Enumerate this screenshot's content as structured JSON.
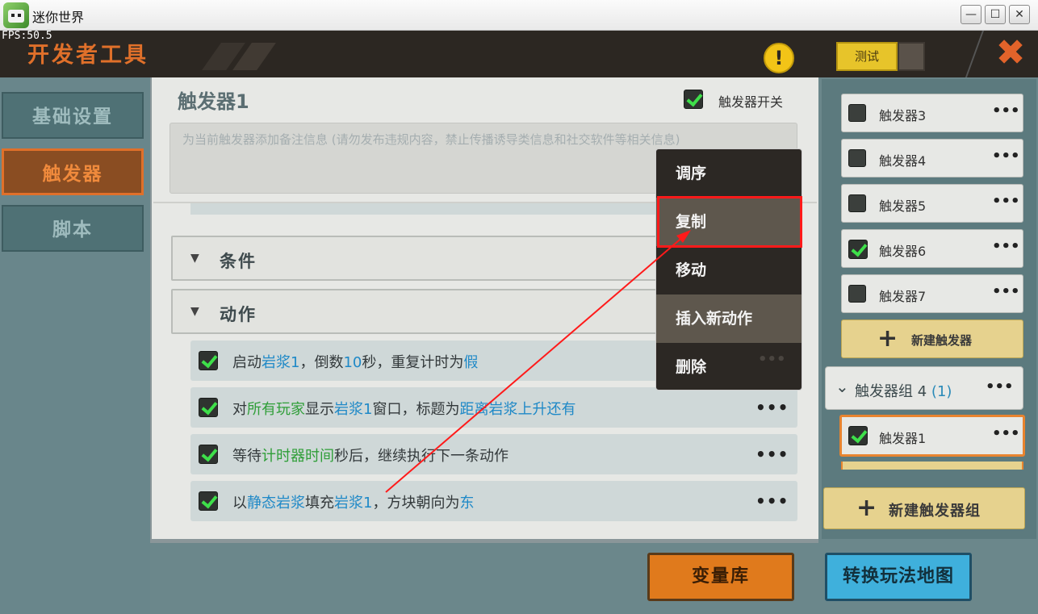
{
  "window": {
    "title": "迷你世界",
    "fps": "FPS:50.5",
    "min": "—",
    "max": "☐",
    "close": "✕"
  },
  "header": {
    "title": "开发者工具",
    "warning": "!",
    "test_label": "测试",
    "close": "✖"
  },
  "sidebar": {
    "items": [
      {
        "label": "基础设置"
      },
      {
        "label": "触发器"
      },
      {
        "label": "脚本"
      }
    ]
  },
  "trigger": {
    "name": "触发器1",
    "switch_label": "触发器开关",
    "note_placeholder": "为当前触发器添加备注信息 (请勿发布违规内容，禁止传播诱导类信息和社交软件等相关信息)"
  },
  "sections": {
    "conditions": "条件",
    "actions": "动作",
    "add": "+"
  },
  "actions": [
    {
      "parts": [
        {
          "t": "启动",
          "c": "n"
        },
        {
          "t": "岩浆1",
          "c": "p"
        },
        {
          "t": "，倒数",
          "c": "n"
        },
        {
          "t": "10",
          "c": "p"
        },
        {
          "t": "秒，重复计时为",
          "c": "n"
        },
        {
          "t": "假",
          "c": "p"
        }
      ]
    },
    {
      "parts": [
        {
          "t": "对",
          "c": "n"
        },
        {
          "t": "所有玩家",
          "c": "g"
        },
        {
          "t": "显示",
          "c": "n"
        },
        {
          "t": "岩浆1",
          "c": "p"
        },
        {
          "t": "窗口，标题为",
          "c": "n"
        },
        {
          "t": "距离岩浆上升还有",
          "c": "p"
        }
      ]
    },
    {
      "parts": [
        {
          "t": "等待",
          "c": "n"
        },
        {
          "t": "计时器时间",
          "c": "g"
        },
        {
          "t": "秒后，继续执行下一条动作",
          "c": "n"
        }
      ]
    },
    {
      "parts": [
        {
          "t": "以",
          "c": "n"
        },
        {
          "t": "静态岩浆",
          "c": "p"
        },
        {
          "t": "填充",
          "c": "n"
        },
        {
          "t": "岩浆1",
          "c": "p"
        },
        {
          "t": "，方块朝向为",
          "c": "n"
        },
        {
          "t": "东",
          "c": "p"
        }
      ]
    }
  ],
  "dots": "•••",
  "context_menu": {
    "items": [
      "调序",
      "复制",
      "移动",
      "插入新动作",
      "删除"
    ]
  },
  "right_panel": {
    "triggers": [
      {
        "label": "触发器3",
        "checked": false
      },
      {
        "label": "触发器4",
        "checked": false
      },
      {
        "label": "触发器5",
        "checked": false
      },
      {
        "label": "触发器6",
        "checked": true
      },
      {
        "label": "触发器7",
        "checked": false
      }
    ],
    "new_trigger": "新建触发器",
    "group": {
      "label": "触发器组 4",
      "count": "(1)",
      "chevron": "⌄"
    },
    "selected_trigger": "触发器1",
    "new_group": "新建触发器组"
  },
  "bottom": {
    "variables": "变量库",
    "convert_map": "转换玩法地图"
  }
}
